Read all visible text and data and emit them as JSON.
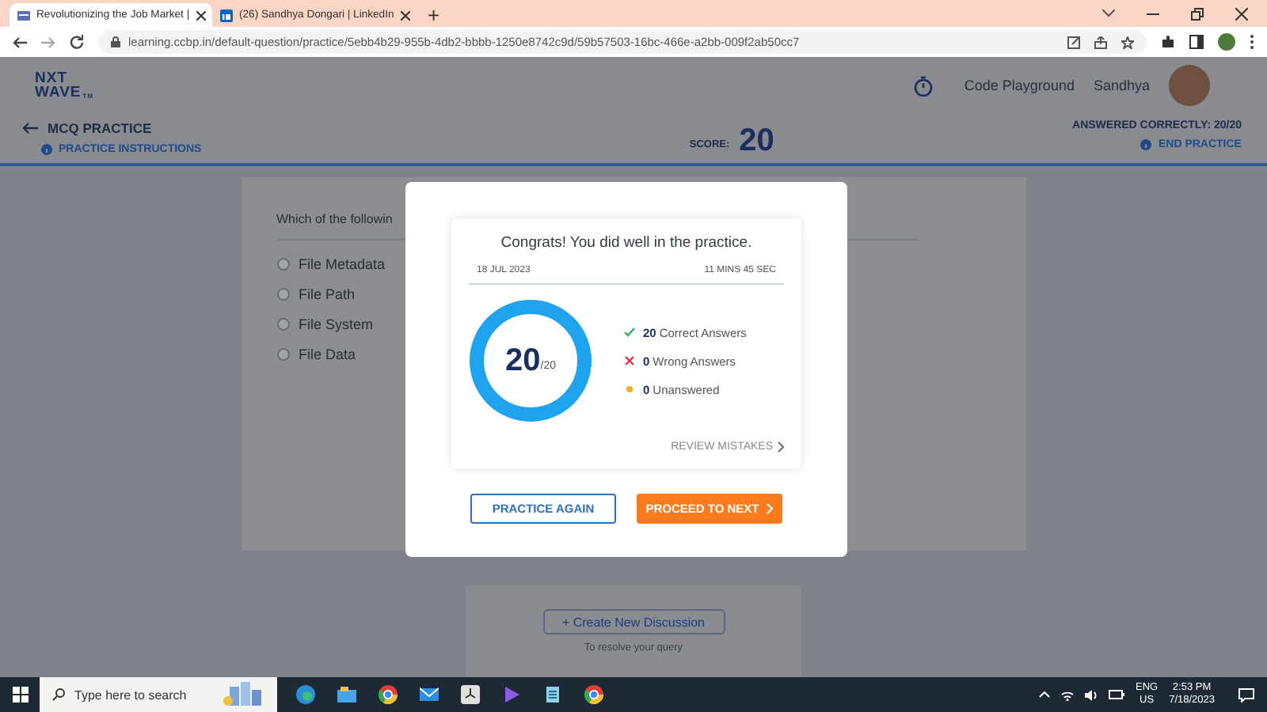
{
  "browser": {
    "tabs": [
      {
        "title": "Revolutionizing the Job Market |",
        "selected": true
      },
      {
        "title": "(26) Sandhya Dongari | LinkedIn",
        "selected": false
      }
    ],
    "new_tab": "+",
    "url": "learning.ccbp.in/default-question/practice/5ebb4b29-955b-4db2-bbbb-1250e8742c9d/59b57503-16bc-466e-a2bb-009f2ab50cc7"
  },
  "header": {
    "logo": [
      "NXT",
      "WAVE"
    ],
    "logo_mark": "TM",
    "nav_link": "Code Playground",
    "user_name": "Sandhya"
  },
  "practice_bar": {
    "title": "MCQ PRACTICE",
    "instructions_link": "PRACTICE INSTRUCTIONS",
    "score_label": "SCORE:",
    "score": "20",
    "answered": "ANSWERED CORRECTLY: 20/20",
    "end_link": "END PRACTICE"
  },
  "question": {
    "text": "Which of the followin",
    "options": [
      {
        "label": "File Metadata",
        "selected": false
      },
      {
        "label": "File Path",
        "selected": false
      },
      {
        "label": "File System",
        "selected": false
      },
      {
        "label": "File Data",
        "selected": false
      }
    ]
  },
  "discussion": {
    "button": "+ Create New Discussion",
    "hint": "To resolve your query"
  },
  "result_modal": {
    "heading": "Congrats! You did well in the practice.",
    "date": "18 JUL 2023",
    "duration": "11 MINS 45 SEC",
    "score": "20",
    "total": "/20",
    "level": 1,
    "stats": [
      {
        "kind": "correct",
        "count": "20",
        "label": "Correct Answers"
      },
      {
        "kind": "wrong",
        "count": "0",
        "label": "Wrong Answers"
      },
      {
        "kind": "unanswered",
        "count": "0",
        "label": "Unanswered"
      }
    ],
    "review_link": "REVIEW MISTAKES",
    "buttons": [
      {
        "kind": "outline",
        "label": "PRACTICE AGAIN"
      },
      {
        "kind": "primary",
        "label": "PROCEED TO NEXT"
      }
    ]
  },
  "taskbar": {
    "search_placeholder": "Type here to search",
    "language": [
      "ENG",
      "US"
    ],
    "time": "2:53 PM",
    "date": "7/18/2023"
  }
}
